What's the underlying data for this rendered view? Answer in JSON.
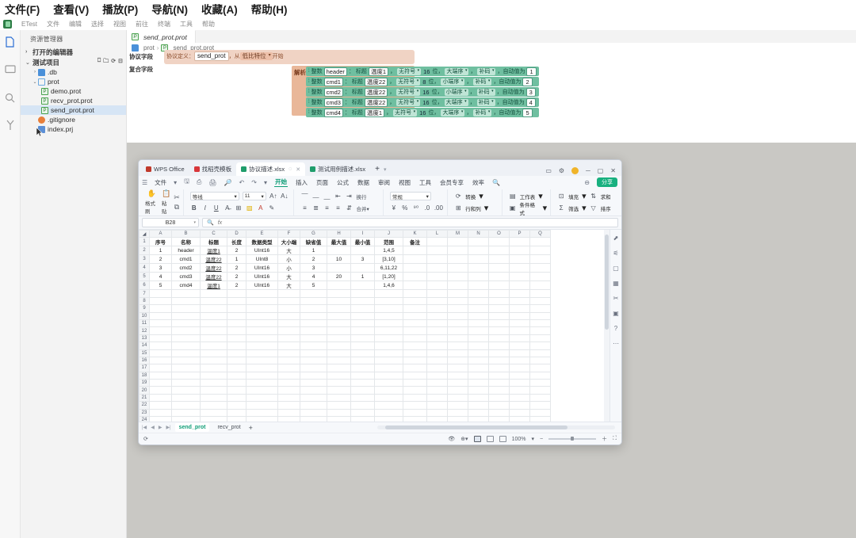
{
  "ide": {
    "top_menu": [
      "文件(F)",
      "查看(V)",
      "播放(P)",
      "导航(N)",
      "收藏(A)",
      "帮助(H)"
    ],
    "sub_menu": [
      "ETest",
      "文件",
      "编辑",
      "选择",
      "视图",
      "前往",
      "终端",
      "工具",
      "帮助"
    ],
    "activity_icons": [
      "explorer-icon",
      "monitor-icon",
      "search-icon",
      "source-control-icon",
      "watch-icon",
      "run-debug-icon"
    ],
    "sidebar": {
      "title": "资源管理器",
      "open_editors": "打开的编辑器",
      "project": "测试项目",
      "project_actions": [
        "new-file-icon",
        "new-folder-icon",
        "refresh-icon",
        "collapse-icon"
      ],
      "items": [
        {
          "label": ".db",
          "type": "folder",
          "indent": 1,
          "arrow": "›"
        },
        {
          "label": "prot",
          "type": "folder-open",
          "indent": 1,
          "arrow": "⌄"
        },
        {
          "label": "demo.prot",
          "type": "prot",
          "indent": 2,
          "arrow": ""
        },
        {
          "label": "recv_prot.prot",
          "type": "prot",
          "indent": 2,
          "arrow": ""
        },
        {
          "label": "send_prot.prot",
          "type": "prot",
          "indent": 2,
          "arrow": "",
          "selected": true
        },
        {
          "label": ".gitignore",
          "type": "gitignore",
          "indent": 1,
          "arrow": ""
        },
        {
          "label": "index.prj",
          "type": "prj",
          "indent": 1,
          "arrow": ""
        }
      ]
    },
    "editor": {
      "tab": "send_prot.prot",
      "breadcrumb": [
        "prot",
        "send_prot.prot"
      ],
      "section_field": "协议字段",
      "section_compound": "复合字段",
      "parse_label": "解析",
      "header_block": {
        "prefix": "协议定义：",
        "name": "send_prot",
        "mid": "，从",
        "endian": "低比特位",
        "suffix": "开始"
      },
      "row_labels": {
        "type": "整数",
        "colon": "：",
        "title_label": "标题",
        "comma": "，",
        "bits_unit": "位，",
        "auto": "，自动值为"
      },
      "rows": [
        {
          "name": "header",
          "title": "温度1",
          "sign": "无符号",
          "bits": "16",
          "endian": "大端序",
          "code": "补码",
          "auto": "1"
        },
        {
          "name": "cmd1",
          "title": "温度22",
          "sign": "无符号",
          "bits": "8",
          "endian": "小端序",
          "code": "补码",
          "auto": "2"
        },
        {
          "name": "cmd2",
          "title": "温度22",
          "sign": "无符号",
          "bits": "16",
          "endian": "小端序",
          "code": "补码",
          "auto": "3"
        },
        {
          "name": "cmd3",
          "title": "温度22",
          "sign": "无符号",
          "bits": "16",
          "endian": "大端序",
          "code": "补码",
          "auto": "4"
        },
        {
          "name": "cmd4",
          "title": "温度1",
          "sign": "无符号",
          "bits": "16",
          "endian": "大端序",
          "code": "补码",
          "auto": "5"
        }
      ]
    }
  },
  "wps": {
    "tabs": [
      {
        "label": "WPS Office",
        "icon": "wps-logo-icon",
        "color": "#c0392b",
        "active": false,
        "closable": false
      },
      {
        "label": "找稻壳模板",
        "icon": "docer-icon",
        "color": "#d8363a",
        "active": false,
        "closable": false
      },
      {
        "label": "协议描述.xlsx",
        "icon": "xlsx-icon",
        "color": "#1f9d6b",
        "active": true,
        "closable": true
      },
      {
        "label": "测试用例描述.xlsx",
        "icon": "xlsx-icon",
        "color": "#1f9d6b",
        "active": false,
        "closable": false
      }
    ],
    "new_tab": "+",
    "window_controls": [
      "minimize",
      "maximize",
      "close"
    ],
    "menu": {
      "file": "文件",
      "quick_icons": [
        "save-icon",
        "print-preview-icon",
        "print-icon",
        "search-icon",
        "undo-icon",
        "redo-icon"
      ],
      "tabs": [
        "开始",
        "插入",
        "页面",
        "公式",
        "数据",
        "审阅",
        "视图",
        "工具",
        "会员专享",
        "效率"
      ],
      "active_tab": "开始",
      "search_icon": "search-icon",
      "share": "分享"
    },
    "ribbon": {
      "paste_group": [
        "格式刷",
        "粘贴"
      ],
      "font_name": "等线",
      "font_size": "11",
      "number_format": "常规",
      "buttons": [
        "换行",
        "合并",
        "转换",
        "行和列",
        "工作表",
        "条件格式",
        "填充",
        "排序",
        "求和",
        "筛选"
      ]
    },
    "formula_bar": {
      "name_box": "B28",
      "formula": "",
      "fx": "fx"
    },
    "sheet_tabs": [
      {
        "label": "send_prot",
        "active": true
      },
      {
        "label": "recv_prot",
        "active": false
      }
    ],
    "add_sheet": "+",
    "status": {
      "zoom": "100%",
      "view_modes": [
        "page-layout-icon",
        "page-break-icon",
        "reading-icon"
      ]
    },
    "chart_data": {
      "type": "table",
      "title": "协议描述.xlsx — send_prot",
      "columns": [
        "A",
        "B",
        "C",
        "D",
        "E",
        "F",
        "G",
        "H",
        "I",
        "J",
        "K",
        "L",
        "M",
        "N",
        "O",
        "P",
        "Q"
      ],
      "headers": [
        "序号",
        "名称",
        "标题",
        "长度",
        "数据类型",
        "大小端",
        "缺省值",
        "最大值",
        "最小值",
        "范围",
        "备注"
      ],
      "rows": [
        [
          "1",
          "header",
          "温度1",
          "2",
          "UInt16",
          "大",
          "1",
          "",
          "",
          "1,4,5",
          ""
        ],
        [
          "2",
          "cmd1",
          "温度22",
          "1",
          "UInt8",
          "小",
          "2",
          "10",
          "3",
          "[3,10]",
          ""
        ],
        [
          "3",
          "cmd2",
          "温度22",
          "2",
          "UInt16",
          "小",
          "3",
          "",
          "",
          "6,11,22",
          ""
        ],
        [
          "4",
          "cmd3",
          "温度22",
          "2",
          "UInt16",
          "大",
          "4",
          "20",
          "1",
          "[1,20]",
          ""
        ],
        [
          "5",
          "cmd4",
          "温度1",
          "2",
          "UInt16",
          "大",
          "5",
          "",
          "",
          "1,4,6",
          ""
        ]
      ],
      "total_visible_rows": 26,
      "selected_column": "B"
    }
  },
  "colors": {
    "accent_green": "#18b07f",
    "block_green": "#6fbfa0",
    "block_orange": "#f0d3c4",
    "selection_blue": "#d6e5f5",
    "desktop": "#c9c8c4"
  }
}
